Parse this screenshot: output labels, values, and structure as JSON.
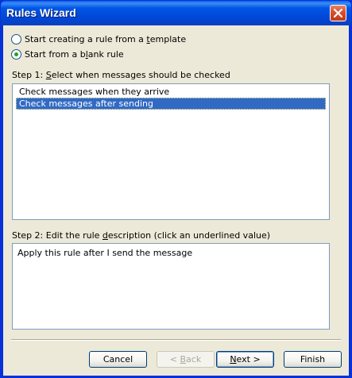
{
  "window": {
    "title": "Rules Wizard",
    "close_icon": "close-icon"
  },
  "options": {
    "template_pre": "Start creating a rule from a ",
    "template_u": "t",
    "template_post": "emplate",
    "blank_pre": "Start from a b",
    "blank_u": "l",
    "blank_post": "ank rule",
    "selected": "blank"
  },
  "step1": {
    "pre": "Step 1: ",
    "u": "S",
    "post": "elect when messages should be checked",
    "items": [
      "Check messages when they arrive",
      "Check messages after sending"
    ],
    "selected_index": 1
  },
  "step2": {
    "pre": "Step 2: Edit the rule ",
    "u": "d",
    "post": "escription (click an underlined value)",
    "description": "Apply this rule after I send the message"
  },
  "buttons": {
    "cancel": "Cancel",
    "back_pre": "< ",
    "back_u": "B",
    "back_post": "ack",
    "next_u": "N",
    "next_post": "ext >",
    "finish": "Finish"
  },
  "colors": {
    "title_bar": "#0055e5",
    "selection": "#316ac5",
    "dialog_bg": "#ece9d8"
  }
}
